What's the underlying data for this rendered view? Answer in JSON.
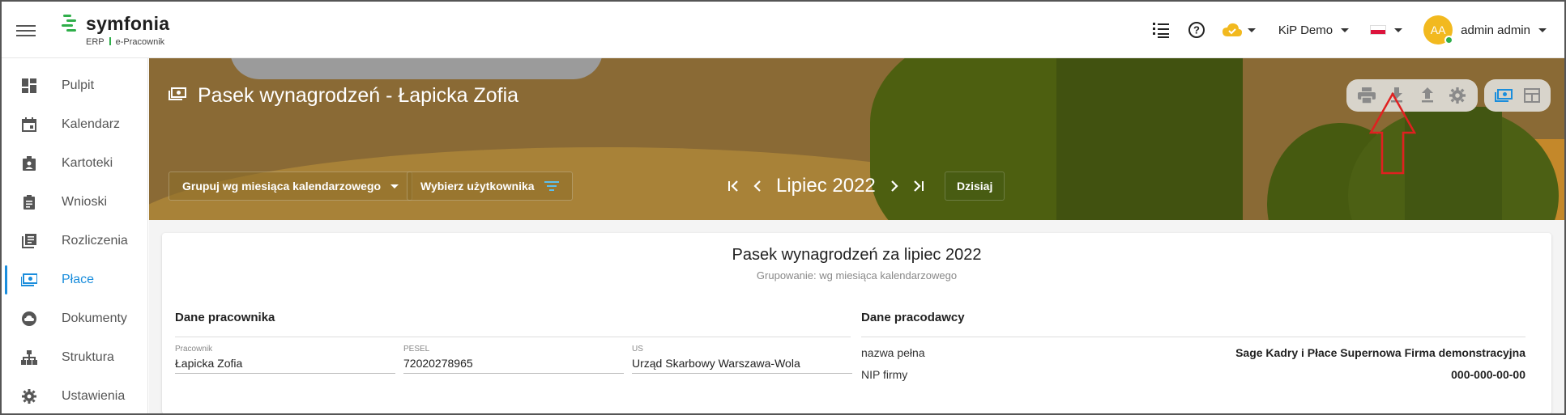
{
  "app": {
    "logo_name": "symfonia",
    "logo_erp": "ERP",
    "logo_module": "e-Pracownik"
  },
  "topbar": {
    "company": "KiP Demo",
    "user_initials": "AA",
    "user_name": "admin admin",
    "icons": [
      "list-icon",
      "help-icon",
      "cloud-status-icon",
      "language-flag-icon"
    ]
  },
  "sidebar": {
    "items": [
      {
        "label": "Pulpit",
        "icon": "dashboard-icon"
      },
      {
        "label": "Kalendarz",
        "icon": "calendar-icon"
      },
      {
        "label": "Kartoteki",
        "icon": "id-badge-icon"
      },
      {
        "label": "Wnioski",
        "icon": "clipboard-icon"
      },
      {
        "label": "Rozliczenia",
        "icon": "document-list-icon"
      },
      {
        "label": "Płace",
        "icon": "money-icon",
        "active": true
      },
      {
        "label": "Dokumenty",
        "icon": "cloud-icon"
      },
      {
        "label": "Struktura",
        "icon": "org-chart-icon"
      },
      {
        "label": "Ustawienia",
        "icon": "gear-icon"
      }
    ]
  },
  "header": {
    "title": "Pasek wynagrodzeń - Łapicka Zofia",
    "group_button": "Grupuj wg miesiąca kalendarzowego",
    "user_filter_button": "Wybierz użytkownika",
    "period": "Lipiec 2022",
    "today_button": "Dzisiaj",
    "tools": [
      "print-icon",
      "download-icon",
      "upload-icon",
      "settings-icon",
      "payslip-view-icon",
      "table-view-icon"
    ]
  },
  "payslip": {
    "title": "Pasek wynagrodzeń za lipiec 2022",
    "subtitle": "Grupowanie: wg miesiąca kalendarzowego",
    "employee_section": "Dane pracownika",
    "employer_section": "Dane pracodawcy",
    "employee_fields": [
      {
        "label": "Pracownik",
        "value": "Łapicka Zofia"
      },
      {
        "label": "PESEL",
        "value": "72020278965"
      },
      {
        "label": "US",
        "value": "Urząd Skarbowy Warszawa-Wola"
      }
    ],
    "employer_rows": [
      {
        "key": "nazwa pełna",
        "value": "Sage Kadry i Płace Supernowa Firma demonstracyjna"
      },
      {
        "key": "NIP firmy",
        "value": "000-000-00-00"
      }
    ]
  },
  "colors": {
    "accent": "#1a8ddc",
    "brand_green": "#2fae4a",
    "avatar": "#f2b91f",
    "annotation_arrow": "#e02020"
  }
}
